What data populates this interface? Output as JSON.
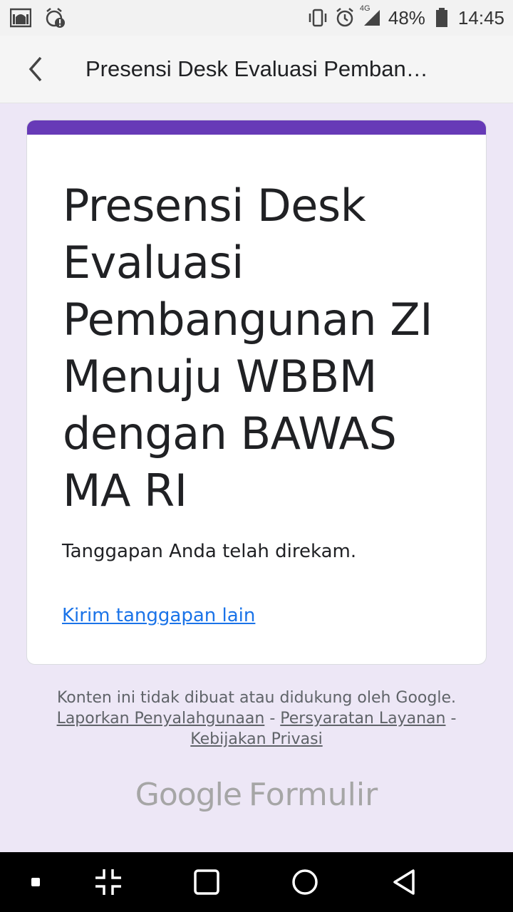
{
  "status_bar": {
    "battery": "48%",
    "time": "14:45",
    "network": "4G"
  },
  "app_bar": {
    "title": "Presensi Desk Evaluasi Pemban…"
  },
  "form": {
    "title": "Presensi Desk Evaluasi Pembangunan ZI Menuju WBBM dengan BAWAS MA RI",
    "confirmation": "Tanggapan Anda telah direkam.",
    "submit_another": "Kirim tanggapan lain"
  },
  "footer": {
    "disclaimer": "Konten ini tidak dibuat atau didukung oleh Google.",
    "report_abuse": "Laporkan Penyalahgunaan",
    "terms": "Persyaratan Layanan",
    "privacy": "Kebijakan Privasi",
    "separator": "-",
    "brand_google": "Google",
    "brand_product": "Formulir"
  },
  "colors": {
    "accent": "#673ab7",
    "background": "#ede7f6",
    "link": "#1a73e8"
  }
}
